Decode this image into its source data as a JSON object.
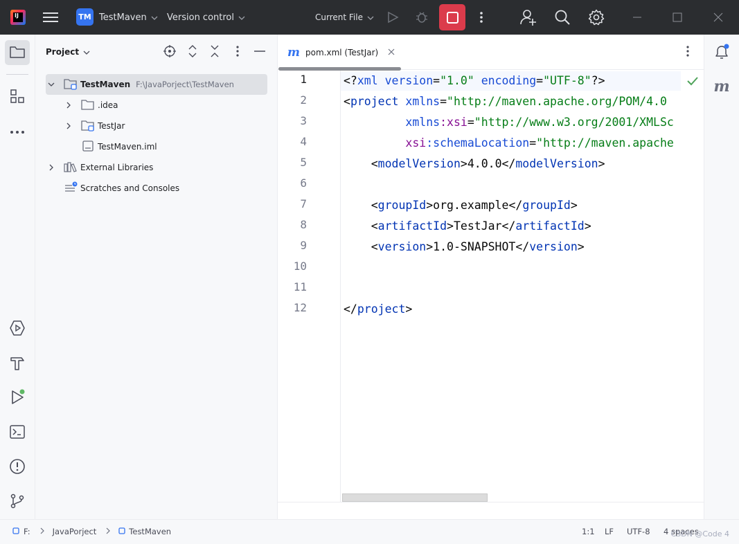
{
  "titlebar": {
    "project_badge": "TM",
    "project_name": "TestMaven",
    "version_control": "Version control",
    "run_config": "Current File"
  },
  "project_panel": {
    "title": "Project",
    "tree": [
      {
        "name": "TestMaven",
        "path": "F:\\JavaPorject\\TestMaven"
      },
      {
        "name": ".idea"
      },
      {
        "name": "TestJar"
      },
      {
        "name": "TestMaven.iml"
      },
      {
        "name": "External Libraries"
      },
      {
        "name": "Scratches and Consoles"
      }
    ]
  },
  "editor": {
    "tab_icon": "m",
    "tab_label": "pom.xml (TestJar)",
    "line_numbers": [
      "1",
      "2",
      "3",
      "4",
      "5",
      "6",
      "7",
      "8",
      "9",
      "10",
      "11",
      "12"
    ],
    "lines": {
      "l1": {
        "a": "<?",
        "b": "xml version",
        "c": "=",
        "d": "\"1.0\"",
        "e": " encoding",
        "f": "=",
        "g": "\"UTF-8\"",
        "h": "?>"
      },
      "l2": {
        "a": "<",
        "b": "project",
        "c": " xmlns",
        "d": "=",
        "e": "\"http://maven.apache.org/POM/4.0"
      },
      "l3": {
        "indent": "         ",
        "a": "xmlns",
        "b": ":xsi",
        "c": "=",
        "d": "\"http://www.w3.org/2001/XMLSc"
      },
      "l4": {
        "indent": "         ",
        "a": "xsi",
        "b": ":schemaLocation",
        "c": "=",
        "d": "\"http://maven.apache"
      },
      "l5": {
        "open": "modelVersion",
        "value": "4.0.0",
        "close": "modelVersion"
      },
      "l7": {
        "open": "groupId",
        "value": "org.example",
        "close": "groupId"
      },
      "l8": {
        "open": "artifactId",
        "value": "TestJar",
        "close": "artifactId"
      },
      "l9": {
        "open": "version",
        "value": "1.0-SNAPSHOT",
        "close": "version"
      },
      "l12": {
        "close": "project"
      }
    }
  },
  "right_bar": {
    "maven_icon": "m"
  },
  "statusbar": {
    "crumbs": [
      "F:",
      "JavaPorject",
      "TestMaven"
    ],
    "position": "1:1",
    "line_sep": "LF",
    "encoding": "UTF-8",
    "indent": "4 spaces",
    "watermark": "CSDN @Code 4"
  }
}
